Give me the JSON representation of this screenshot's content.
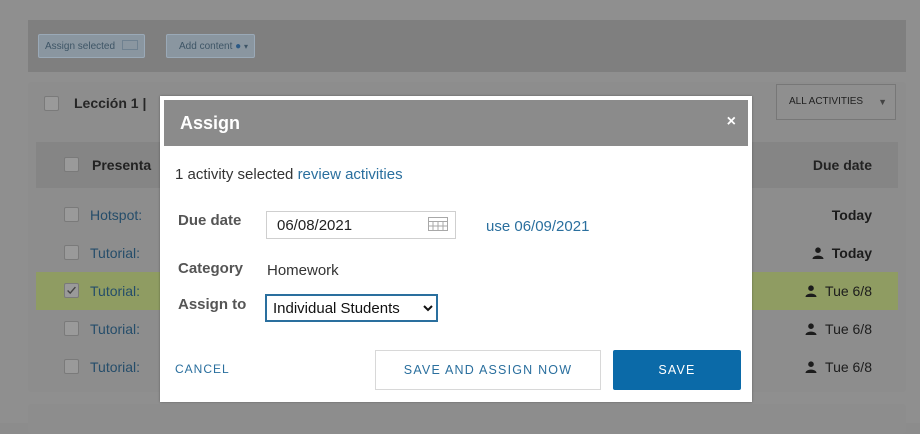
{
  "toolbar": {
    "assign_selected": "Assign selected",
    "add_content": "Add content"
  },
  "lesson": {
    "title": "Lección 1 |",
    "filter": "ALL ACTIVITIES"
  },
  "table": {
    "header_label": "Presenta",
    "header_due": "Due date",
    "rows": [
      {
        "label": "Hotspot:",
        "due": "Today",
        "person": false,
        "checked": false,
        "bold": true
      },
      {
        "label": "Tutorial:",
        "due": "Today",
        "person": true,
        "checked": false,
        "bold": true
      },
      {
        "label": "Tutorial:",
        "due": "Tue 6/8",
        "person": true,
        "checked": true,
        "bold": false
      },
      {
        "label": "Tutorial:",
        "due": "Tue 6/8",
        "person": true,
        "checked": false,
        "bold": false
      },
      {
        "label": "Tutorial:",
        "due": "Tue 6/8",
        "person": true,
        "checked": false,
        "bold": false
      }
    ]
  },
  "modal": {
    "title": "Assign",
    "close": "×",
    "selected_text": "1 activity selected",
    "review_link": "review activities",
    "due_label": "Due date",
    "due_value": "06/08/2021",
    "use_link": "use 06/09/2021",
    "category_label": "Category",
    "category_value": "Homework",
    "assign_label": "Assign to",
    "assign_value": "Individual Students",
    "cancel": "CANCEL",
    "save_assign": "SAVE AND ASSIGN NOW",
    "save": "SAVE"
  },
  "colors": {
    "accent": "#2a6f9e",
    "save_button": "#0b6aa8",
    "modal_header": "#8b8b8b",
    "highlight_row": "#8f9c62"
  }
}
